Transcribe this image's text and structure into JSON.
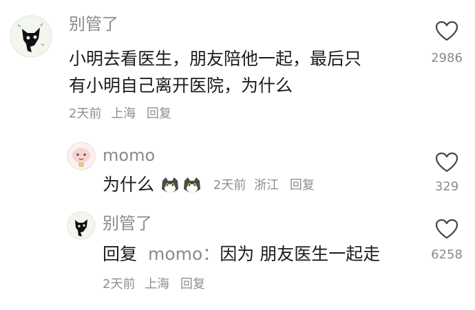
{
  "comment": {
    "username": "别管了",
    "text_line1": "小明去看医生，朋友陪他一起，最后只",
    "text_line2": "有小明自己离开医院，为什么",
    "time": "2天前",
    "location": "上海",
    "reply_label": "回复",
    "likes": "2986"
  },
  "replies": [
    {
      "username": "momo",
      "text": "为什么",
      "emoji": "cat-face-emoji",
      "time": "2天前",
      "location": "浙江",
      "reply_label": "回复",
      "likes": "329"
    },
    {
      "username": "别管了",
      "reply_prefix": "回复",
      "reply_to": "momo：",
      "text": "因为 朋友医生一起走",
      "time": "2天前",
      "location": "上海",
      "reply_label": "回复",
      "likes": "6258"
    }
  ],
  "colors": {
    "text": "#1b1b1b",
    "muted": "#8a8a8a",
    "background": "#ffffff"
  }
}
